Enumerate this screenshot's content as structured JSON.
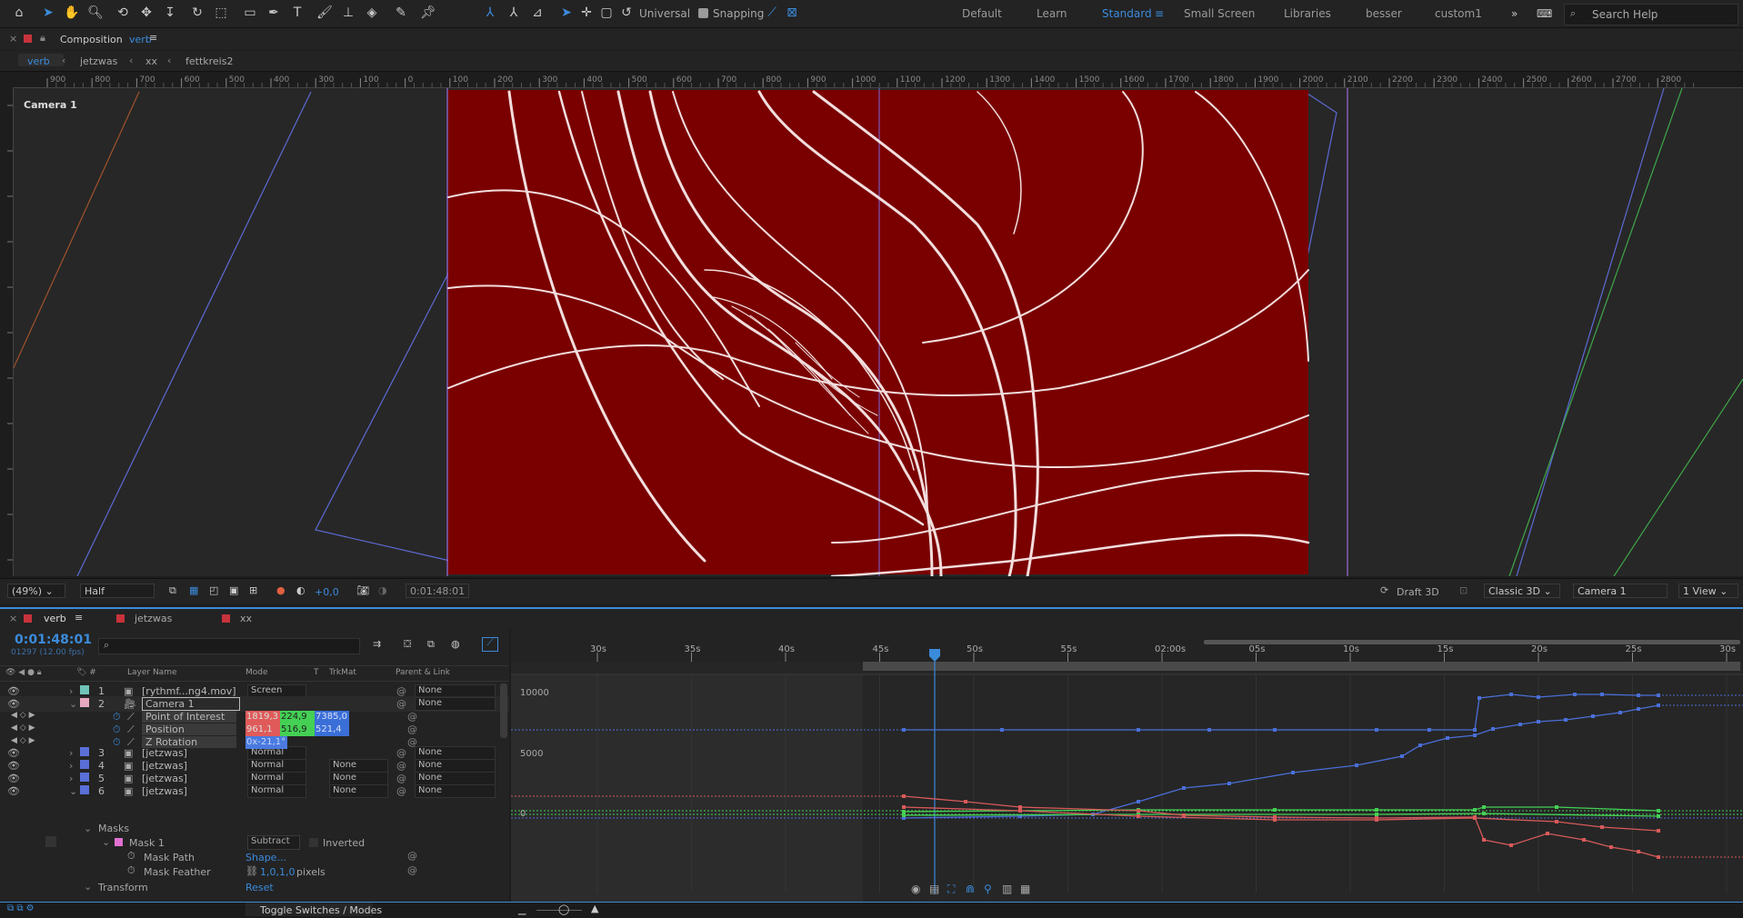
{
  "toolbar": {
    "axis_mode": "Universal",
    "snapping_label": "Snapping",
    "workspaces": [
      "Default",
      "Learn",
      "Standard",
      "Small Screen",
      "Libraries",
      "besser",
      "custom1"
    ],
    "active_workspace": "Standard",
    "search_placeholder": "Search Help"
  },
  "composition": {
    "panel_label": "Composition",
    "name": "verb",
    "breadcrumbs": [
      "verb",
      "jetzwas",
      "xx",
      "fettkreis2"
    ],
    "camera_label": "Camera 1",
    "ruler_ticks": [
      "900",
      "800",
      "700",
      "600",
      "500",
      "400",
      "300",
      "100",
      "0",
      "100",
      "200",
      "300",
      "400",
      "500",
      "600",
      "700",
      "800",
      "900",
      "1000",
      "1100",
      "1200",
      "1300",
      "1400",
      "1500",
      "1600",
      "1700",
      "1800",
      "1900",
      "2000",
      "2100",
      "2200",
      "2300",
      "2400",
      "2500",
      "2600",
      "2700",
      "2800"
    ]
  },
  "viewer_controls": {
    "magnification": "(49%)",
    "resolution": "Half",
    "exposure": "+0,0",
    "timecode": "0:01:48:01",
    "renderer_draft": "Draft 3D",
    "renderer": "Classic 3D",
    "camera": "Camera 1",
    "views": "1 View"
  },
  "timeline": {
    "tabs": [
      {
        "name": "verb",
        "color": "#c8323c"
      },
      {
        "name": "jetzwas",
        "color": "#c8323c"
      },
      {
        "name": "xx",
        "color": "#c8323c"
      }
    ],
    "current_time": "0:01:48:01",
    "frame_info": "01297 (12.00 fps)",
    "columns": {
      "layer_name": "Layer Name",
      "mode": "Mode",
      "t": "T",
      "trkmat": "TrkMat",
      "parent": "Parent & Link"
    },
    "time_ticks": [
      "30s",
      "35s",
      "40s",
      "45s",
      "50s",
      "55s",
      "02:00s",
      "05s",
      "10s",
      "15s",
      "20s",
      "25s",
      "30s"
    ],
    "graph_labels": [
      "10000",
      "5000",
      "0"
    ],
    "toggle_label": "Toggle Switches / Modes",
    "layers": [
      {
        "num": "1",
        "name": "[rythmf...ng4.mov]",
        "mode": "Screen",
        "trkmat": "",
        "parent": "None",
        "color": "#6fc3b8"
      },
      {
        "num": "2",
        "name": "Camera 1",
        "mode": "",
        "trkmat": "",
        "parent": "None",
        "color": "#e6a8c0"
      },
      {
        "num": "3",
        "name": "[jetzwas]",
        "mode": "Normal",
        "trkmat": "",
        "parent": "None",
        "color": "#5a6fd8"
      },
      {
        "num": "4",
        "name": "[jetzwas]",
        "mode": "Normal",
        "trkmat": "None",
        "parent": "None",
        "color": "#5a6fd8"
      },
      {
        "num": "5",
        "name": "[jetzwas]",
        "mode": "Normal",
        "trkmat": "None",
        "parent": "None",
        "color": "#5a6fd8"
      },
      {
        "num": "6",
        "name": "[jetzwas]",
        "mode": "Normal",
        "trkmat": "None",
        "parent": "None",
        "color": "#5a6fd8"
      }
    ],
    "camera_props": [
      {
        "name": "Point of Interest",
        "values": [
          "1819,3",
          "224,9",
          "7385,0"
        ]
      },
      {
        "name": "Position",
        "values": [
          "961,1",
          "516,9",
          "521,4"
        ]
      },
      {
        "name": "Z Rotation",
        "values": [
          "0x-21,1°"
        ]
      }
    ],
    "masks_group": "Masks",
    "mask1": {
      "name": "Mask 1",
      "mode": "Subtract",
      "inverted": "Inverted"
    },
    "mask_path": {
      "name": "Mask Path",
      "value": "Shape..."
    },
    "mask_feather": {
      "name": "Mask Feather",
      "value": "1,0,1,0",
      "unit": "pixels"
    },
    "transform": {
      "name": "Transform",
      "value": "Reset"
    }
  }
}
